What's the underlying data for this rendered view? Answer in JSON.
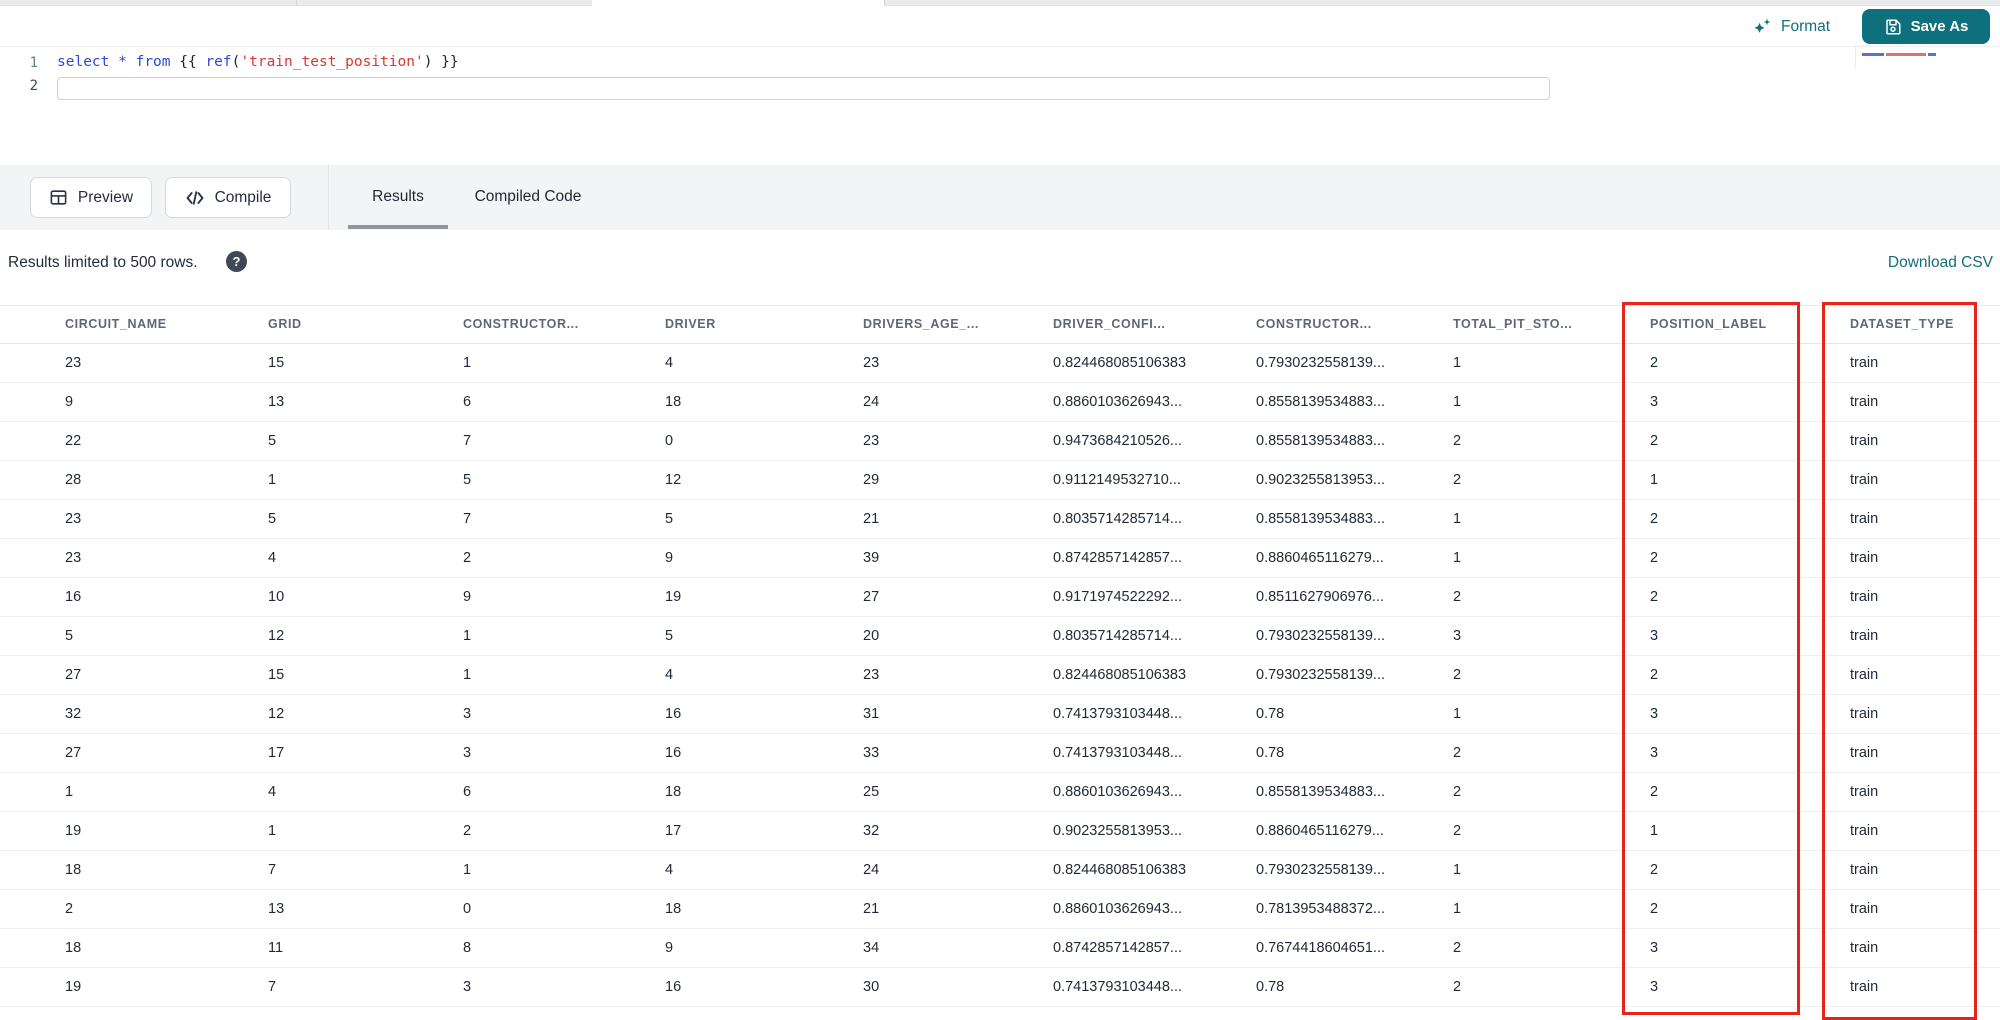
{
  "toolbar": {
    "format_label": "Format",
    "save_as_label": "Save As"
  },
  "editor": {
    "lines": [
      {
        "number": "1",
        "segments": [
          {
            "text": "select",
            "type": "keyword"
          },
          {
            "text": " ",
            "type": "plain"
          },
          {
            "text": "*",
            "type": "operator"
          },
          {
            "text": " ",
            "type": "plain"
          },
          {
            "text": "from",
            "type": "keyword"
          },
          {
            "text": " ",
            "type": "plain"
          },
          {
            "text": "{{ ",
            "type": "brace"
          },
          {
            "text": "ref",
            "type": "func"
          },
          {
            "text": "(",
            "type": "paren"
          },
          {
            "text": "'train_test_position'",
            "type": "string"
          },
          {
            "text": ")",
            "type": "paren"
          },
          {
            "text": " }}",
            "type": "brace"
          }
        ]
      },
      {
        "number": "2",
        "segments": []
      }
    ]
  },
  "actions": {
    "preview_label": "Preview",
    "compile_label": "Compile"
  },
  "tabs": [
    {
      "label": "Results",
      "active": true
    },
    {
      "label": "Compiled Code",
      "active": false
    }
  ],
  "results_bar": {
    "message": "Results limited to 500 rows.",
    "help_glyph": "?",
    "download_label": "Download CSV"
  },
  "table": {
    "headers": [
      "CIRCUIT_NAME",
      "GRID",
      "CONSTRUCTOR...",
      "DRIVER",
      "DRIVERS_AGE_...",
      "DRIVER_CONFI...",
      "CONSTRUCTOR...",
      "TOTAL_PIT_STO...",
      "POSITION_LABEL",
      "DATASET_TYPE"
    ],
    "highlighted_headers": [
      "POSITION_LABEL",
      "DATASET_TYPE"
    ],
    "rows": [
      [
        "23",
        "15",
        "1",
        "4",
        "23",
        "0.824468085106383",
        "0.7930232558139...",
        "1",
        "2",
        "train"
      ],
      [
        "9",
        "13",
        "6",
        "18",
        "24",
        "0.8860103626943...",
        "0.8558139534883...",
        "1",
        "3",
        "train"
      ],
      [
        "22",
        "5",
        "7",
        "0",
        "23",
        "0.9473684210526...",
        "0.8558139534883...",
        "2",
        "2",
        "train"
      ],
      [
        "28",
        "1",
        "5",
        "12",
        "29",
        "0.9112149532710...",
        "0.9023255813953...",
        "2",
        "1",
        "train"
      ],
      [
        "23",
        "5",
        "7",
        "5",
        "21",
        "0.8035714285714...",
        "0.8558139534883...",
        "1",
        "2",
        "train"
      ],
      [
        "23",
        "4",
        "2",
        "9",
        "39",
        "0.8742857142857...",
        "0.8860465116279...",
        "1",
        "2",
        "train"
      ],
      [
        "16",
        "10",
        "9",
        "19",
        "27",
        "0.9171974522292...",
        "0.8511627906976...",
        "2",
        "2",
        "train"
      ],
      [
        "5",
        "12",
        "1",
        "5",
        "20",
        "0.8035714285714...",
        "0.7930232558139...",
        "3",
        "3",
        "train"
      ],
      [
        "27",
        "15",
        "1",
        "4",
        "23",
        "0.824468085106383",
        "0.7930232558139...",
        "2",
        "2",
        "train"
      ],
      [
        "32",
        "12",
        "3",
        "16",
        "31",
        "0.7413793103448...",
        "0.78",
        "1",
        "3",
        "train"
      ],
      [
        "27",
        "17",
        "3",
        "16",
        "33",
        "0.7413793103448...",
        "0.78",
        "2",
        "3",
        "train"
      ],
      [
        "1",
        "4",
        "6",
        "18",
        "25",
        "0.8860103626943...",
        "0.8558139534883...",
        "2",
        "2",
        "train"
      ],
      [
        "19",
        "1",
        "2",
        "17",
        "32",
        "0.9023255813953...",
        "0.8860465116279...",
        "2",
        "1",
        "train"
      ],
      [
        "18",
        "7",
        "1",
        "4",
        "24",
        "0.824468085106383",
        "0.7930232558139...",
        "1",
        "2",
        "train"
      ],
      [
        "2",
        "13",
        "0",
        "18",
        "21",
        "0.8860103626943...",
        "0.7813953488372...",
        "1",
        "2",
        "train"
      ],
      [
        "18",
        "11",
        "8",
        "9",
        "34",
        "0.8742857142857...",
        "0.7674418604651...",
        "2",
        "3",
        "train"
      ],
      [
        "19",
        "7",
        "3",
        "16",
        "30",
        "0.7413793103448...",
        "0.78",
        "2",
        "3",
        "train"
      ]
    ]
  },
  "colors": {
    "accent_teal": "#0e6f7d",
    "highlight_red": "#e8231a"
  }
}
